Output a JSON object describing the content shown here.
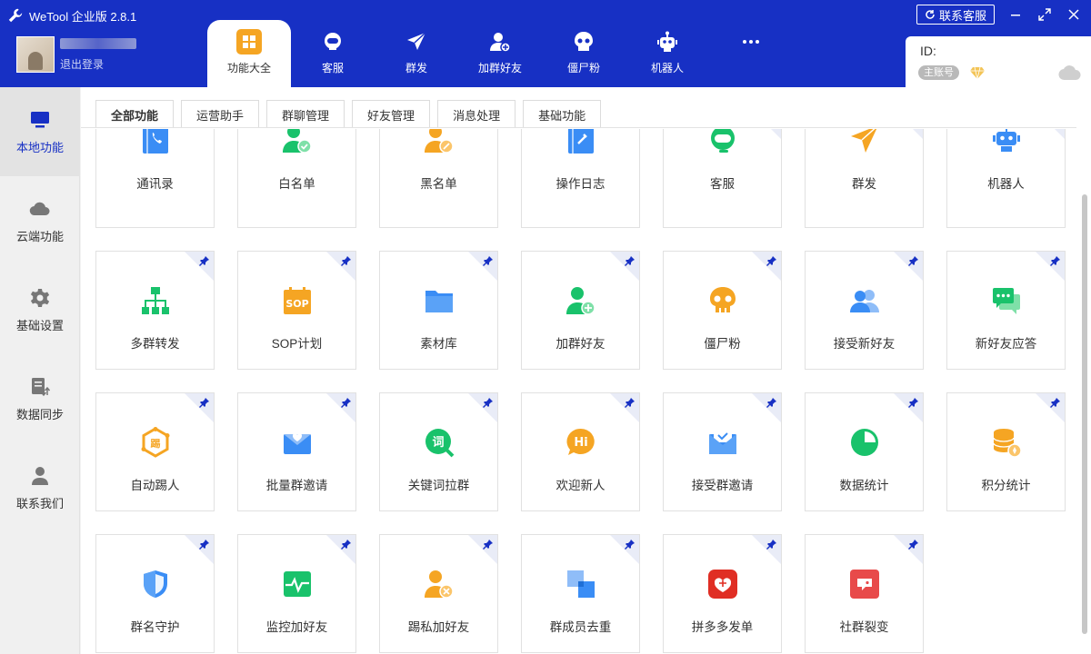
{
  "app": {
    "title": "WeTool 企业版 2.8.1",
    "contact_label": "联系客服"
  },
  "user": {
    "logout_label": "退出登录"
  },
  "nav": [
    {
      "label": "功能大全",
      "icon": "apps-grid-icon"
    },
    {
      "label": "客服",
      "icon": "headset-icon"
    },
    {
      "label": "群发",
      "icon": "paper-plane-icon"
    },
    {
      "label": "加群好友",
      "icon": "add-friend-icon"
    },
    {
      "label": "僵尸粉",
      "icon": "skull-icon"
    },
    {
      "label": "机器人",
      "icon": "robot-icon"
    },
    {
      "label": "",
      "icon": "more-dots-icon"
    }
  ],
  "account": {
    "id_label": "ID:",
    "badge": "主账号"
  },
  "sidebar": [
    {
      "label": "本地功能",
      "icon": "monitor-icon"
    },
    {
      "label": "云端功能",
      "icon": "cloud-icon"
    },
    {
      "label": "基础设置",
      "icon": "gear-icon"
    },
    {
      "label": "数据同步",
      "icon": "sync-icon"
    },
    {
      "label": "联系我们",
      "icon": "person-icon"
    }
  ],
  "tabs": [
    "全部功能",
    "运营助手",
    "群聊管理",
    "好友管理",
    "消息处理",
    "基础功能"
  ],
  "features": [
    [
      "通讯录",
      "白名单",
      "黑名单",
      "操作日志",
      "客服",
      "群发",
      "机器人"
    ],
    [
      "多群转发",
      "SOP计划",
      "素材库",
      "加群好友",
      "僵尸粉",
      "接受新好友",
      "新好友应答"
    ],
    [
      "自动踢人",
      "批量群邀请",
      "关键词拉群",
      "欢迎新人",
      "接受群邀请",
      "数据统计",
      "积分统计"
    ],
    [
      "群名守护",
      "监控加好友",
      "踢私加好友",
      "群成员去重",
      "拼多多发单",
      "社群裂变"
    ]
  ],
  "colors": {
    "header": "#1730c4",
    "green": "#19c26b",
    "orange": "#f5a523",
    "blue": "#3a8df5"
  }
}
